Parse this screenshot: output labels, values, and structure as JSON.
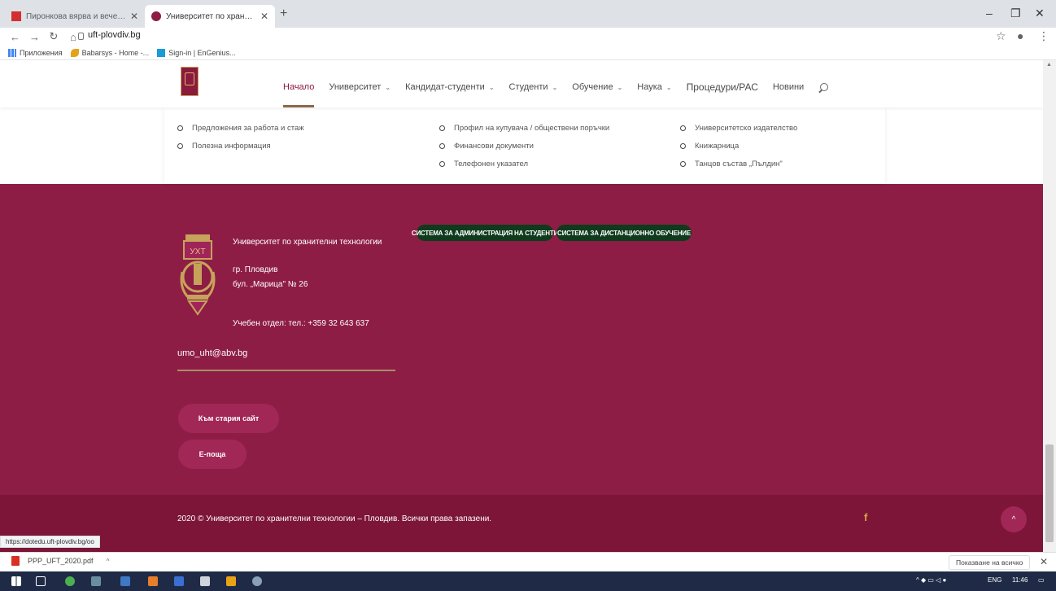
{
  "browser": {
    "tabs": [
      {
        "title": "Пиронкова вярва и вече знае..."
      },
      {
        "title": "Университет по хранителни тех..."
      }
    ],
    "new_tab": "+",
    "url": "uft-plovdiv.bg",
    "bookmarks": [
      {
        "label": "Приложения"
      },
      {
        "label": "Babarsys - Home -..."
      },
      {
        "label": "Sign-in | EnGenius..."
      }
    ],
    "status_url": "https://dotedu.uft-plovdiv.bg/oo"
  },
  "site": {
    "menu": [
      {
        "label": "Начало",
        "dropdown": false,
        "active": true
      },
      {
        "label": "Университет",
        "dropdown": true
      },
      {
        "label": "Кандидат-студенти",
        "dropdown": true
      },
      {
        "label": "Студенти",
        "dropdown": true
      },
      {
        "label": "Обучение",
        "dropdown": true
      },
      {
        "label": "Наука",
        "dropdown": true
      },
      {
        "label": "Процедури/РАС",
        "dropdown": false
      },
      {
        "label": "Новини",
        "dropdown": false
      }
    ],
    "panel": {
      "col1": [
        "Предложения за работа и стаж",
        "Полезна информация"
      ],
      "col2": [
        "Профил на купувача / обществени поръчки",
        "Финансови документи",
        "Телефонен указател"
      ],
      "col3": [
        "Университетско издателство",
        "Книжарница",
        "Танцов състав „Пълдин\""
      ]
    },
    "footer": {
      "crest_text": "УХТ",
      "university": "Университет по хранителни технологии",
      "city": "гр. Пловдив",
      "address": "бул. „Марица\" № 26",
      "phone": "Учебен отдел: тел.: +359 32 643 637",
      "email": "umo_uht@abv.bg",
      "btn_student_admin": "СИСТЕМА ЗА АДМИНИСТРАЦИЯ НА СТУДЕНТИ",
      "btn_distance": "СИСТЕМА ЗА ДИСТАНЦИОННО ОБУЧЕНИЕ",
      "btn_old_site": "Към стария сайт",
      "btn_email": "Е-поща",
      "copyright": "2020 © Университет по хранителни технологии – Пловдив. Всички права запазени.",
      "facebook": "f",
      "to_top": "^"
    }
  },
  "shelf": {
    "file": "PPP_UFT_2020.pdf",
    "show_all": "Показване на всичко"
  },
  "taskbar": {
    "lang": "ENG",
    "time": "11:46"
  },
  "colors": {
    "maroon": "#8e1d45",
    "dark_maroon": "#7c1537",
    "pill_green": "#0e3b1c",
    "accent_gold": "#a98c68"
  }
}
